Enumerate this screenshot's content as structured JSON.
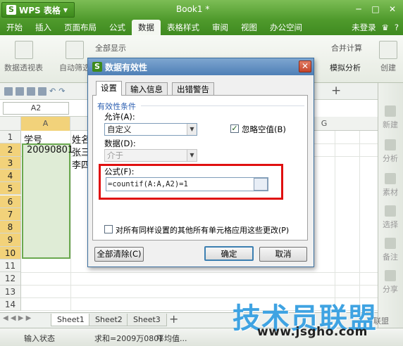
{
  "app": {
    "name": "WPS 表格",
    "document_title": "Book1 *"
  },
  "menu": {
    "tabs": [
      "开始",
      "插入",
      "页面布局",
      "公式",
      "数据",
      "表格样式",
      "审阅",
      "视图",
      "办公空间"
    ],
    "active_tab": "数据",
    "login": "未登录"
  },
  "ribbon": {
    "pivot": "数据透视表",
    "autofilter": "自动筛选",
    "show_all": "全部显示",
    "merge_calc": "合并计算",
    "simulate": "模拟分析",
    "create": "创建"
  },
  "name_box": "A2",
  "columns": [
    "A",
    "G"
  ],
  "rows": [
    "1",
    "2",
    "3",
    "4",
    "5",
    "6",
    "7",
    "8",
    "9",
    "10",
    "11",
    "12",
    "13",
    "14"
  ],
  "cells": {
    "A1": "学号",
    "B1": "姓名",
    "A2": "20090801",
    "B2": "张三",
    "B3": "李四"
  },
  "sheets": [
    "Sheet1",
    "Sheet2",
    "Sheet3"
  ],
  "active_sheet": "Sheet1",
  "sheet_add": "+",
  "status": {
    "mode": "输入状态",
    "sum": "求和=2009万0801",
    "avg": "平均值..."
  },
  "right_panel": [
    "新建",
    "分析",
    "素材",
    "选择",
    "备注",
    "分享"
  ],
  "watermark": {
    "main": "技术员联盟",
    "url": "www.jsgho.com",
    "label": "联盟"
  },
  "dialog": {
    "title": "数据有效性",
    "tabs": [
      "设置",
      "输入信息",
      "出错警告"
    ],
    "active_tab": "设置",
    "group_title": "有效性条件",
    "allow_label": "允许(A):",
    "allow_value": "自定义",
    "ignore_blank_label": "忽略空值(B)",
    "ignore_blank_checked": true,
    "data_label": "数据(D):",
    "data_value": "介于",
    "formula_label": "公式(F):",
    "formula_value": "=countif(A:A,A2)=1",
    "apply_all_label": "对所有同样设置的其他所有单元格应用这些更改(P)",
    "apply_all_checked": false,
    "clear_all": "全部清除(C)",
    "ok": "确定",
    "cancel": "取消"
  },
  "colors": {
    "titlebar": "#4f9a2c",
    "dialog_title": "#4e7fb6",
    "highlight": "#e01010",
    "selection": "#dfecd6",
    "watermark": "#3fa3e2"
  }
}
